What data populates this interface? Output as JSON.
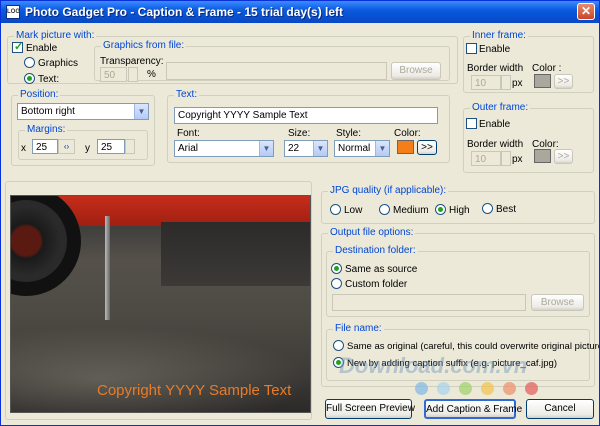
{
  "window": {
    "title": "Photo Gadget Pro - Caption & Frame - 15 trial day(s) left",
    "app_icon": "LOG"
  },
  "mark": {
    "label": "Mark picture with:",
    "enable": "Enable",
    "graphics": "Graphics",
    "text": "Text:"
  },
  "graphics_file": {
    "label": "Graphics from file:",
    "transparency_label": "Transparency:",
    "transparency_value": "50",
    "percent": "%",
    "path_value": "",
    "browse": "Browse"
  },
  "position": {
    "label": "Position:",
    "value": "Bottom right",
    "margins_label": "Margins:",
    "x_label": "x",
    "x_value": "25",
    "y_label": "y",
    "y_value": "25"
  },
  "text_group": {
    "label": "Text:",
    "value": "Copyright YYYY Sample Text",
    "font_label": "Font:",
    "font_value": "Arial",
    "size_label": "Size:",
    "size_value": "22",
    "style_label": "Style:",
    "style_value": "Normal",
    "color_label": "Color:",
    "color_hex": "#f57e1a",
    "more": ">>"
  },
  "inner_frame": {
    "label": "Inner frame:",
    "enable": "Enable",
    "border_width_label": "Border width",
    "border_value": "10",
    "px": "px",
    "color_label": "Color :",
    "color_hex": "#aaa89c",
    "more": ">>"
  },
  "outer_frame": {
    "label": "Outer frame:",
    "enable": "Enable",
    "border_width_label": "Border width",
    "border_value": "10",
    "px": "px",
    "color_label": "Color:",
    "color_hex": "#aaa89c",
    "more": ">>"
  },
  "preview": {
    "caption": "Copyright YYYY Sample Text"
  },
  "jpg": {
    "label": "JPG quality (if applicable):",
    "options": [
      "Low",
      "Medium",
      "High",
      "Best"
    ],
    "selected": "High"
  },
  "output": {
    "label": "Output file options:",
    "dest_label": "Destination folder:",
    "same_as_source": "Same as source",
    "custom_folder": "Custom folder",
    "folder_path": "",
    "browse": "Browse",
    "filename_label": "File name:",
    "same_as_original": "Same as original (careful, this could overwrite original picture!)",
    "new_by_suffix": "New by adding caption suffix (e.g. picture_caf.jpg)"
  },
  "watermark": "Download.com.vn",
  "buttons": {
    "full_screen": "Full Screen Preview",
    "add_caption": "Add Caption & Frame",
    "cancel": "Cancel"
  }
}
